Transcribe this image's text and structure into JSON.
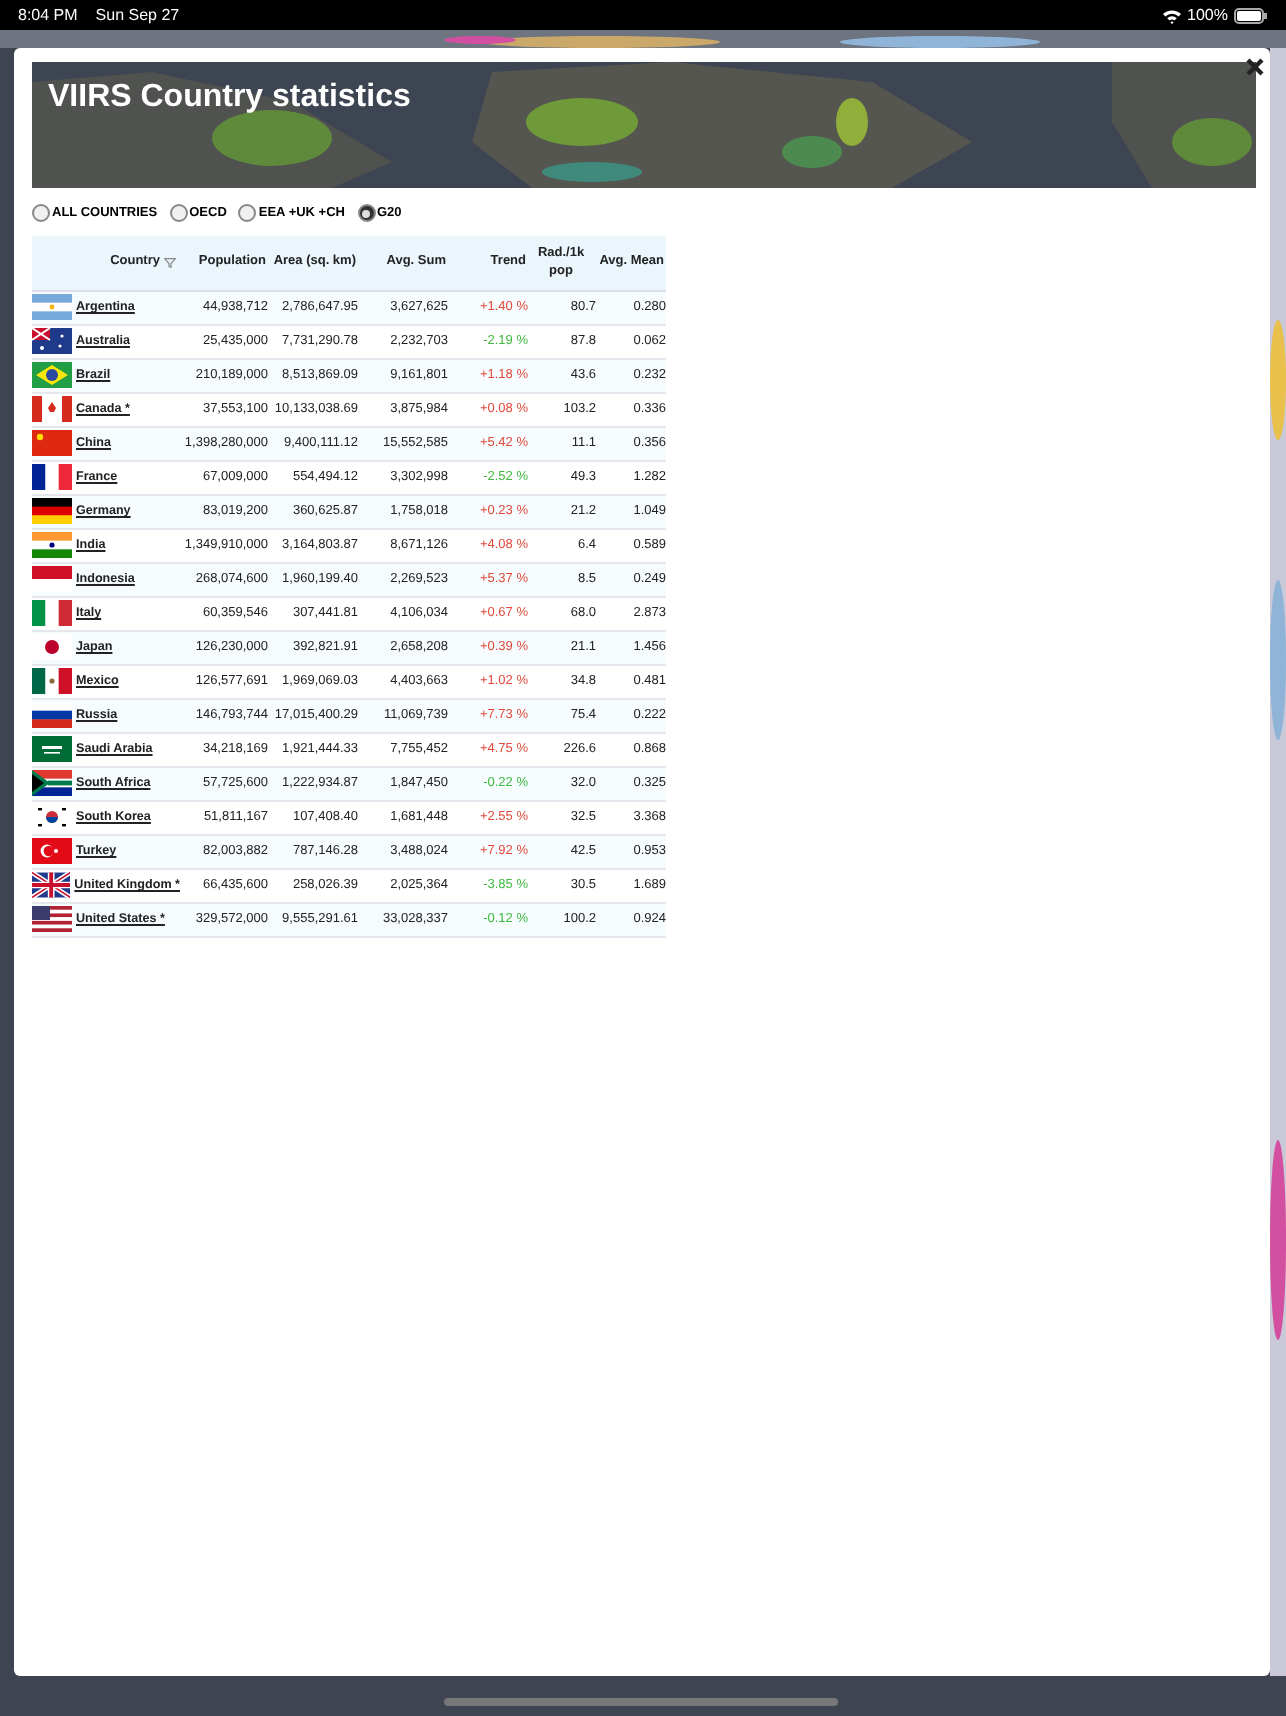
{
  "status_bar": {
    "time": "8:04 PM",
    "date": "Sun Sep 27",
    "battery": "100%"
  },
  "dialog": {
    "title": "VIIRS Country statistics"
  },
  "filters": [
    {
      "label": "ALL COUNTRIES",
      "selected": false
    },
    {
      "label": "OECD",
      "selected": false
    },
    {
      "label": "EEA +UK +CH",
      "selected": false
    },
    {
      "label": "G20",
      "selected": true
    }
  ],
  "table": {
    "columns": [
      "Country",
      "Population",
      "Area (sq. km)",
      "Avg. Sum",
      "Trend",
      "Rad./1k pop",
      "Avg. Mean"
    ],
    "rows": [
      {
        "country": "Argentina",
        "population": "44,938,712",
        "area": "2,786,647.95",
        "avg_sum": "3,627,625",
        "trend": {
          "text": "+1.40 %",
          "color": "#e04a3c"
        },
        "rad": "80.7",
        "mean": "0.280"
      },
      {
        "country": "Australia",
        "population": "25,435,000",
        "area": "7,731,290.78",
        "avg_sum": "2,232,703",
        "trend": {
          "text": "-2.19 %",
          "color": "#3fb93f"
        },
        "rad": "87.8",
        "mean": "0.062"
      },
      {
        "country": "Brazil",
        "population": "210,189,000",
        "area": "8,513,869.09",
        "avg_sum": "9,161,801",
        "trend": {
          "text": "+1.18 %",
          "color": "#e04a3c"
        },
        "rad": "43.6",
        "mean": "0.232"
      },
      {
        "country": "Canada *",
        "population": "37,553,100",
        "area": "10,133,038.69",
        "avg_sum": "3,875,984",
        "trend": {
          "text": "+0.08 %",
          "color": "#e04a3c"
        },
        "rad": "103.2",
        "mean": "0.336"
      },
      {
        "country": "China",
        "population": "1,398,280,000",
        "area": "9,400,111.12",
        "avg_sum": "15,552,585",
        "trend": {
          "text": "+5.42 %",
          "color": "#e04a3c"
        },
        "rad": "11.1",
        "mean": "0.356"
      },
      {
        "country": "France",
        "population": "67,009,000",
        "area": "554,494.12",
        "avg_sum": "3,302,998",
        "trend": {
          "text": "-2.52 %",
          "color": "#3fb93f"
        },
        "rad": "49.3",
        "mean": "1.282"
      },
      {
        "country": "Germany",
        "population": "83,019,200",
        "area": "360,625.87",
        "avg_sum": "1,758,018",
        "trend": {
          "text": "+0.23 %",
          "color": "#e04a3c"
        },
        "rad": "21.2",
        "mean": "1.049"
      },
      {
        "country": "India",
        "population": "1,349,910,000",
        "area": "3,164,803.87",
        "avg_sum": "8,671,126",
        "trend": {
          "text": "+4.08 %",
          "color": "#e04a3c"
        },
        "rad": "6.4",
        "mean": "0.589"
      },
      {
        "country": "Indonesia",
        "population": "268,074,600",
        "area": "1,960,199.40",
        "avg_sum": "2,269,523",
        "trend": {
          "text": "+5.37 %",
          "color": "#e04a3c"
        },
        "rad": "8.5",
        "mean": "0.249"
      },
      {
        "country": "Italy",
        "population": "60,359,546",
        "area": "307,441.81",
        "avg_sum": "4,106,034",
        "trend": {
          "text": "+0.67 %",
          "color": "#e04a3c"
        },
        "rad": "68.0",
        "mean": "2.873"
      },
      {
        "country": "Japan",
        "population": "126,230,000",
        "area": "392,821.91",
        "avg_sum": "2,658,208",
        "trend": {
          "text": "+0.39 %",
          "color": "#e04a3c"
        },
        "rad": "21.1",
        "mean": "1.456"
      },
      {
        "country": "Mexico",
        "population": "126,577,691",
        "area": "1,969,069.03",
        "avg_sum": "4,403,663",
        "trend": {
          "text": "+1.02 %",
          "color": "#e04a3c"
        },
        "rad": "34.8",
        "mean": "0.481"
      },
      {
        "country": "Russia",
        "population": "146,793,744",
        "area": "17,015,400.29",
        "avg_sum": "11,069,739",
        "trend": {
          "text": "+7.73 %",
          "color": "#e04a3c"
        },
        "rad": "75.4",
        "mean": "0.222"
      },
      {
        "country": "Saudi Arabia",
        "population": "34,218,169",
        "area": "1,921,444.33",
        "avg_sum": "7,755,452",
        "trend": {
          "text": "+4.75 %",
          "color": "#e04a3c"
        },
        "rad": "226.6",
        "mean": "0.868"
      },
      {
        "country": "South Africa",
        "population": "57,725,600",
        "area": "1,222,934.87",
        "avg_sum": "1,847,450",
        "trend": {
          "text": "-0.22 %",
          "color": "#3fb93f"
        },
        "rad": "32.0",
        "mean": "0.325"
      },
      {
        "country": "South Korea",
        "population": "51,811,167",
        "area": "107,408.40",
        "avg_sum": "1,681,448",
        "trend": {
          "text": "+2.55 %",
          "color": "#e04a3c"
        },
        "rad": "32.5",
        "mean": "3.368"
      },
      {
        "country": "Turkey",
        "population": "82,003,882",
        "area": "787,146.28",
        "avg_sum": "3,488,024",
        "trend": {
          "text": "+7.92 %",
          "color": "#e04a3c"
        },
        "rad": "42.5",
        "mean": "0.953"
      },
      {
        "country": "United Kingdom *",
        "population": "66,435,600",
        "area": "258,026.39",
        "avg_sum": "2,025,364",
        "trend": {
          "text": "-3.85 %",
          "color": "#3fb93f"
        },
        "rad": "30.5",
        "mean": "1.689"
      },
      {
        "country": "United States *",
        "population": "329,572,000",
        "area": "9,555,291.61",
        "avg_sum": "33,028,337",
        "trend": {
          "text": "-0.12 %",
          "color": "#3fb93f"
        },
        "rad": "100.2",
        "mean": "0.924"
      }
    ]
  }
}
